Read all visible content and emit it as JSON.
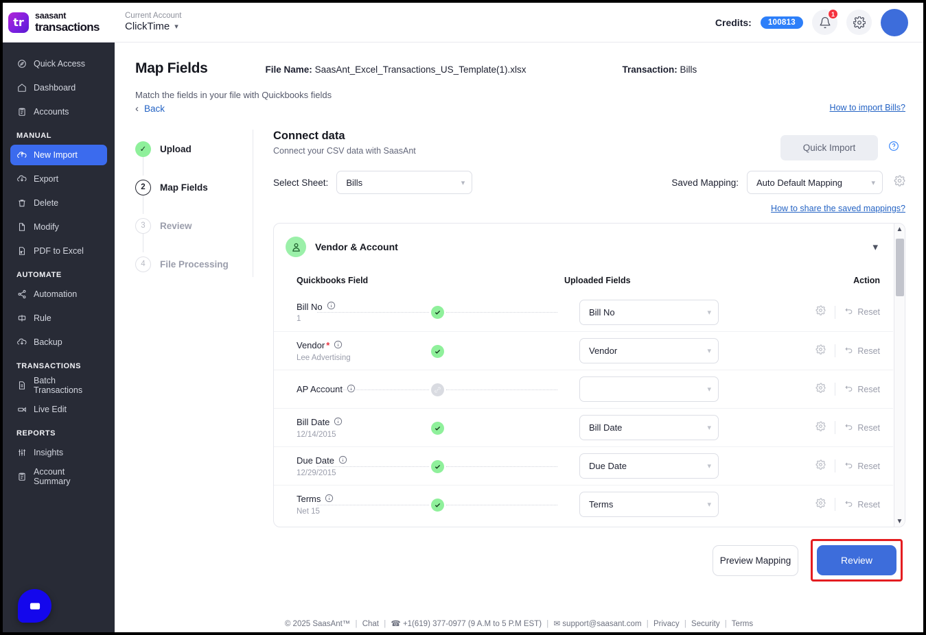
{
  "topbar": {
    "logo_text": "tr",
    "brand_line1": "saasant",
    "brand_line2": "transactions",
    "account_label": "Current Account",
    "account_name": "ClickTime",
    "credits_label": "Credits:",
    "credits_value": "100813",
    "notification_count": "1"
  },
  "sidebar": {
    "items": [
      {
        "label": "Quick Access",
        "icon": "compass-icon",
        "active": false
      },
      {
        "label": "Dashboard",
        "icon": "home-icon",
        "active": false
      },
      {
        "label": "Accounts",
        "icon": "clipboard-icon",
        "active": false
      }
    ],
    "groups": [
      {
        "title": "MANUAL",
        "items": [
          {
            "label": "New Import",
            "icon": "upload-cloud-icon",
            "active": true
          },
          {
            "label": "Export",
            "icon": "download-cloud-icon",
            "active": false
          },
          {
            "label": "Delete",
            "icon": "trash-icon",
            "active": false
          },
          {
            "label": "Modify",
            "icon": "file-edit-icon",
            "active": false
          },
          {
            "label": "PDF to Excel",
            "icon": "pdf-file-icon",
            "active": false
          }
        ]
      },
      {
        "title": "AUTOMATE",
        "items": [
          {
            "label": "Automation",
            "icon": "share-nodes-icon",
            "active": false
          },
          {
            "label": "Rule",
            "icon": "rule-icon",
            "active": false
          },
          {
            "label": "Backup",
            "icon": "download-cloud-icon",
            "active": false
          }
        ]
      },
      {
        "title": "TRANSACTIONS",
        "items": [
          {
            "label": "Batch Transactions",
            "icon": "document-icon",
            "active": false
          },
          {
            "label": "Live Edit",
            "icon": "edit-row-icon",
            "active": false
          }
        ]
      },
      {
        "title": "REPORTS",
        "items": [
          {
            "label": "Insights",
            "icon": "sliders-icon",
            "active": false
          },
          {
            "label": "Account Summary",
            "icon": "clipboard-icon",
            "active": false
          }
        ]
      }
    ]
  },
  "page": {
    "title": "Map Fields",
    "file_name_label": "File Name:",
    "file_name_value": "SaasAnt_Excel_Transactions_US_Template(1).xlsx",
    "transaction_label": "Transaction:",
    "transaction_value": "Bills",
    "subtitle": "Match the fields in your file with Quickbooks fields",
    "how_to_import_link": "How to import Bills?",
    "back_label": "Back"
  },
  "stepper": [
    {
      "num": "1",
      "label": "Upload",
      "state": "done"
    },
    {
      "num": "2",
      "label": "Map Fields",
      "state": "active"
    },
    {
      "num": "3",
      "label": "Review",
      "state": "todo"
    },
    {
      "num": "4",
      "label": "File Processing",
      "state": "todo"
    }
  ],
  "connect": {
    "title": "Connect data",
    "subtitle": "Connect your CSV data with SaasAnt",
    "quick_import_label": "Quick Import",
    "select_sheet_label": "Select Sheet:",
    "select_sheet_value": "Bills",
    "saved_mapping_label": "Saved Mapping:",
    "saved_mapping_value": "Auto Default Mapping",
    "share_mappings_link": "How to share the saved mappings?"
  },
  "mapping": {
    "section_title": "Vendor & Account",
    "columns": {
      "quickbooks_field": "Quickbooks Field",
      "uploaded_fields": "Uploaded Fields",
      "action": "Action"
    },
    "reset_label": "Reset",
    "rows": [
      {
        "field": "Bill No",
        "required": false,
        "sample": "1",
        "mapped_value": "Bill No",
        "status": "mapped",
        "dots": true
      },
      {
        "field": "Vendor",
        "required": true,
        "sample": "Lee Advertising",
        "mapped_value": "Vendor",
        "status": "mapped",
        "dots": false
      },
      {
        "field": "AP Account",
        "required": false,
        "sample": "",
        "mapped_value": "",
        "status": "unmapped",
        "dots": true
      },
      {
        "field": "Bill Date",
        "required": false,
        "sample": "12/14/2015",
        "mapped_value": "Bill Date",
        "status": "mapped",
        "dots": false
      },
      {
        "field": "Due Date",
        "required": false,
        "sample": "12/29/2015",
        "mapped_value": "Due Date",
        "status": "mapped",
        "dots": true
      },
      {
        "field": "Terms",
        "required": false,
        "sample": "Net 15",
        "mapped_value": "Terms",
        "status": "mapped",
        "dots": true
      }
    ]
  },
  "actions": {
    "preview_label": "Preview Mapping",
    "review_label": "Review",
    "highlight_color": "#e41d20"
  },
  "footer": {
    "copyright": "© 2025 SaasAnt™",
    "chat": "Chat",
    "phone": "+1(619) 377-0977 (9 A.M to 5 P.M EST)",
    "email": "support@saasant.com",
    "privacy": "Privacy",
    "security": "Security",
    "terms": "Terms"
  },
  "colors": {
    "accent_blue": "#3d6ddb",
    "sidebar_bg": "#282b36",
    "success_green": "#8ff09b",
    "link_blue": "#2463c4"
  }
}
